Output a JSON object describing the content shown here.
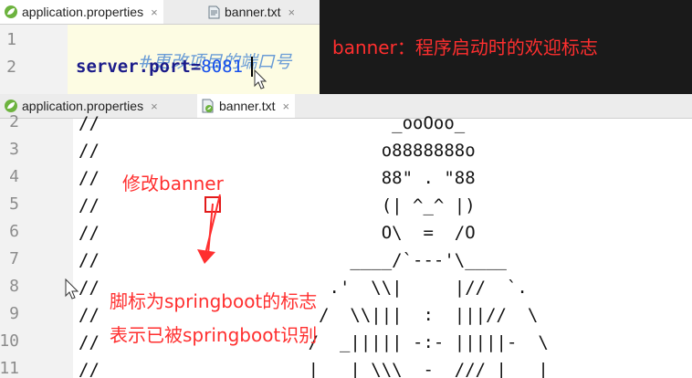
{
  "top_editor": {
    "tabs": [
      {
        "label": "application.properties",
        "close": "×",
        "active": true
      },
      {
        "label": "banner.txt",
        "close": "×",
        "active": false
      }
    ],
    "line_numbers": [
      "1",
      "2"
    ],
    "comment": "#更改项目的端口号",
    "property_key": "server.port=",
    "property_value": "8081"
  },
  "notes": {
    "banner_desc": "banner：程序启动时的欢迎标志",
    "modify_banner": "修改banner",
    "footer_line1": "脚标为springboot的标志",
    "footer_line2": "表示已被springboot识别"
  },
  "bottom_editor": {
    "tabs": [
      {
        "label": "application.properties",
        "close": "×",
        "active": false
      },
      {
        "label": "banner.txt",
        "close": "×",
        "active": true
      }
    ],
    "line_numbers": [
      "2",
      "3",
      "4",
      "5",
      "6",
      "7",
      "8",
      "9",
      "10",
      "11"
    ],
    "art_lines": [
      "//                            _ooOoo_",
      "//                           o8888888o",
      "//                           88\" . \"88",
      "//                           (| ^_^ |)",
      "//                           O\\  =  /O",
      "//                        ____/`---'\\____",
      "//                      .'  \\\\|     |//  `.",
      "//                     /  \\\\|||  :  |||//  \\",
      "//                    /  _||||| -:- |||||-  \\",
      "//                    |   | \\\\\\  -  /// |   |"
    ]
  },
  "colors": {
    "annotation_red": "#ff2f2f",
    "dark_bg": "#1a1a1a",
    "highlight_line": "#fdfce3"
  }
}
